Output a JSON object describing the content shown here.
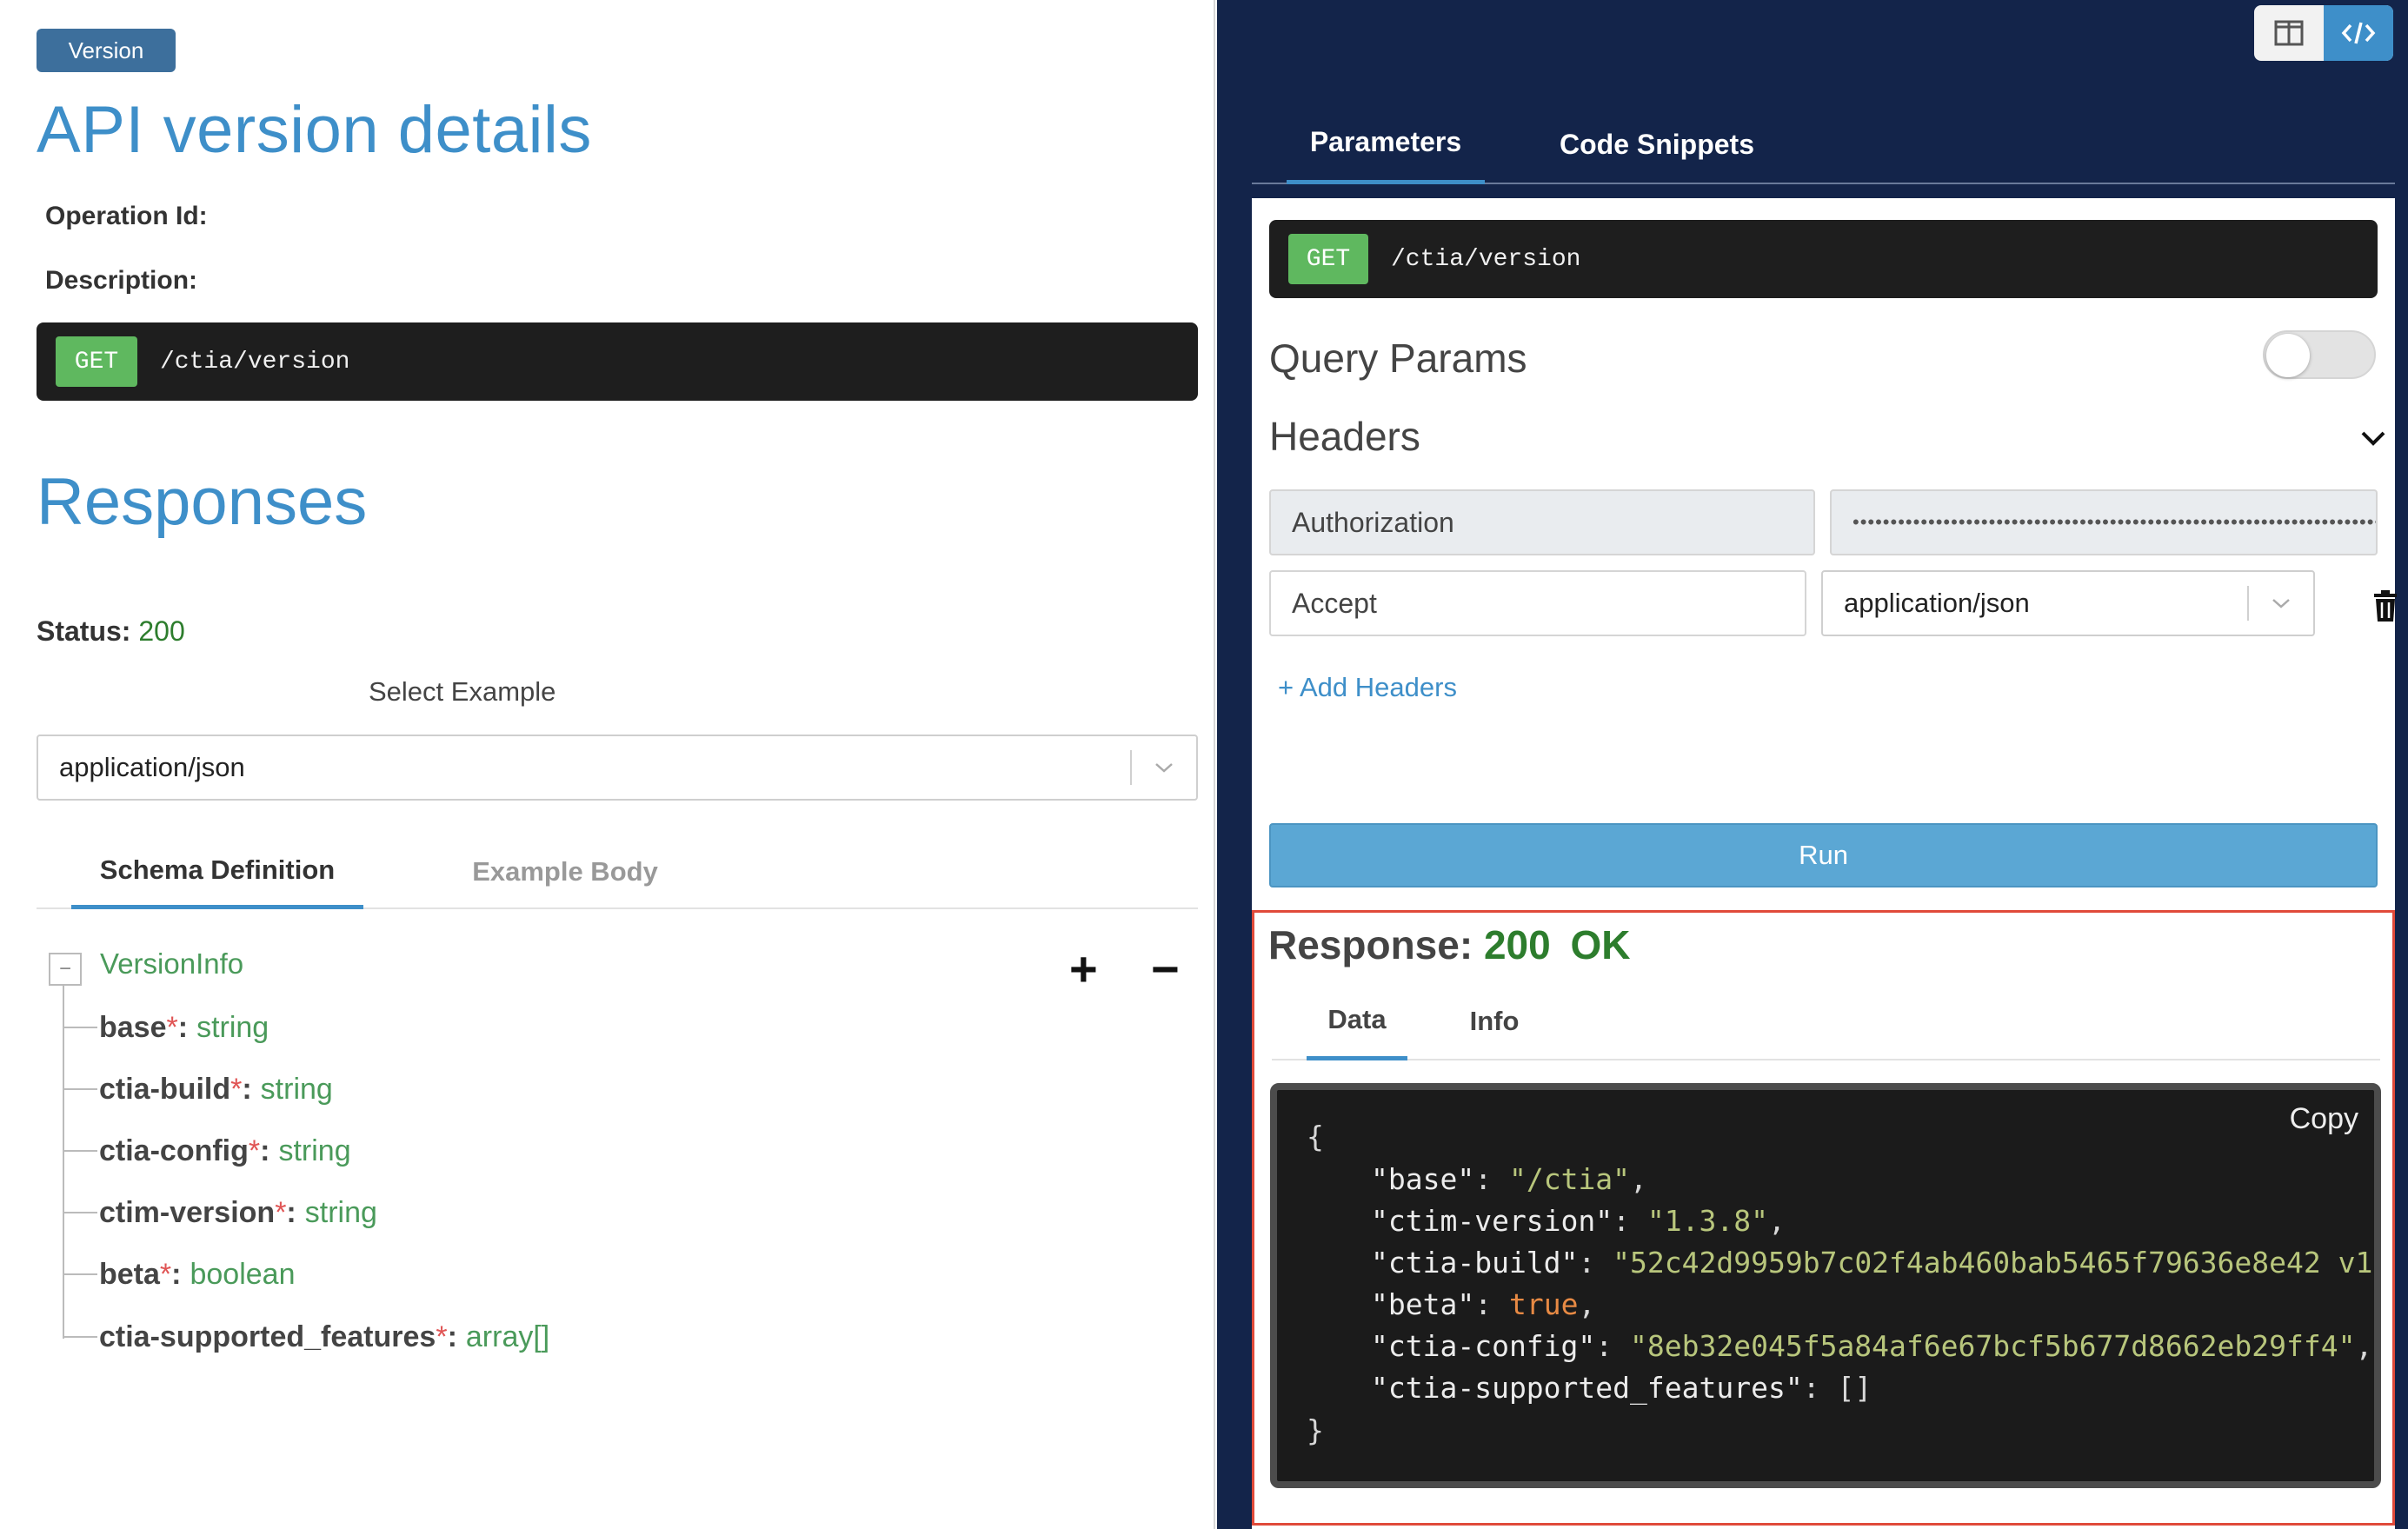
{
  "left": {
    "version_badge": "Version",
    "title": "API version details",
    "operation_id_label": "Operation Id:",
    "description_label": "Description:",
    "endpoint": {
      "method": "GET",
      "path": "/ctia/version"
    },
    "responses_title": "Responses",
    "status_label": "Status:",
    "status_value": "200",
    "select_example_label": "Select Example",
    "content_type": "application/json",
    "tabs": [
      "Schema Definition",
      "Example Body"
    ],
    "tree": {
      "collapse_symbol": "−",
      "root": "VersionInfo",
      "expand_symbol": "+",
      "collapse_all_symbol": "−",
      "fields": [
        {
          "name": "base",
          "type": "string"
        },
        {
          "name": "ctia-build",
          "type": "string"
        },
        {
          "name": "ctia-config",
          "type": "string"
        },
        {
          "name": "ctim-version",
          "type": "string"
        },
        {
          "name": "beta",
          "type": "boolean"
        },
        {
          "name": "ctia-supported_features",
          "type": "array[]"
        }
      ],
      "required_marker": "*"
    }
  },
  "right": {
    "tabs": [
      "Parameters",
      "Code Snippets"
    ],
    "endpoint": {
      "method": "GET",
      "path": "/ctia/version"
    },
    "query_params_label": "Query Params",
    "query_params_enabled": false,
    "headers_label": "Headers",
    "headers": [
      {
        "name": "Authorization",
        "value": "••••••••••••••••••••••••••••••••••••••••••••••••••••••••••••••••••••••••••••"
      },
      {
        "name": "Accept",
        "value": "application/json"
      }
    ],
    "add_headers": "+ Add Headers",
    "run_label": "Run",
    "response": {
      "label": "Response:",
      "code": "200",
      "status": "OK",
      "tabs": [
        "Data",
        "Info"
      ],
      "copy_label": "Copy",
      "lines": [
        {
          "indent": 0,
          "open": "{"
        },
        {
          "indent": 1,
          "key": "\"base\"",
          "value": "\"/ctia\"",
          "kind": "str",
          "comma": true
        },
        {
          "indent": 1,
          "key": "\"ctim-version\"",
          "value": "\"1.3.8\"",
          "kind": "str",
          "comma": true
        },
        {
          "indent": 1,
          "key": "\"ctia-build\"",
          "value": "\"52c42d9959b7c02f4ab460bab5465f79636e8e42 v1",
          "kind": "str",
          "comma": false
        },
        {
          "indent": 1,
          "key": "\"beta\"",
          "value": "true",
          "kind": "bool",
          "comma": true
        },
        {
          "indent": 1,
          "key": "\"ctia-config\"",
          "value": "\"8eb32e045f5a84af6e67bcf5b677d8662eb29ff4\"",
          "kind": "str",
          "comma": true
        },
        {
          "indent": 1,
          "key": "\"ctia-supported_features\"",
          "value": "[]",
          "kind": "pun",
          "comma": false
        },
        {
          "indent": 0,
          "open": "}"
        }
      ]
    }
  },
  "colors": {
    "accent": "#3e8fc9",
    "get": "#5fb85f",
    "ok": "#2d7d2d",
    "right_bg": "#13244a",
    "highlight": "#e04a3a"
  }
}
